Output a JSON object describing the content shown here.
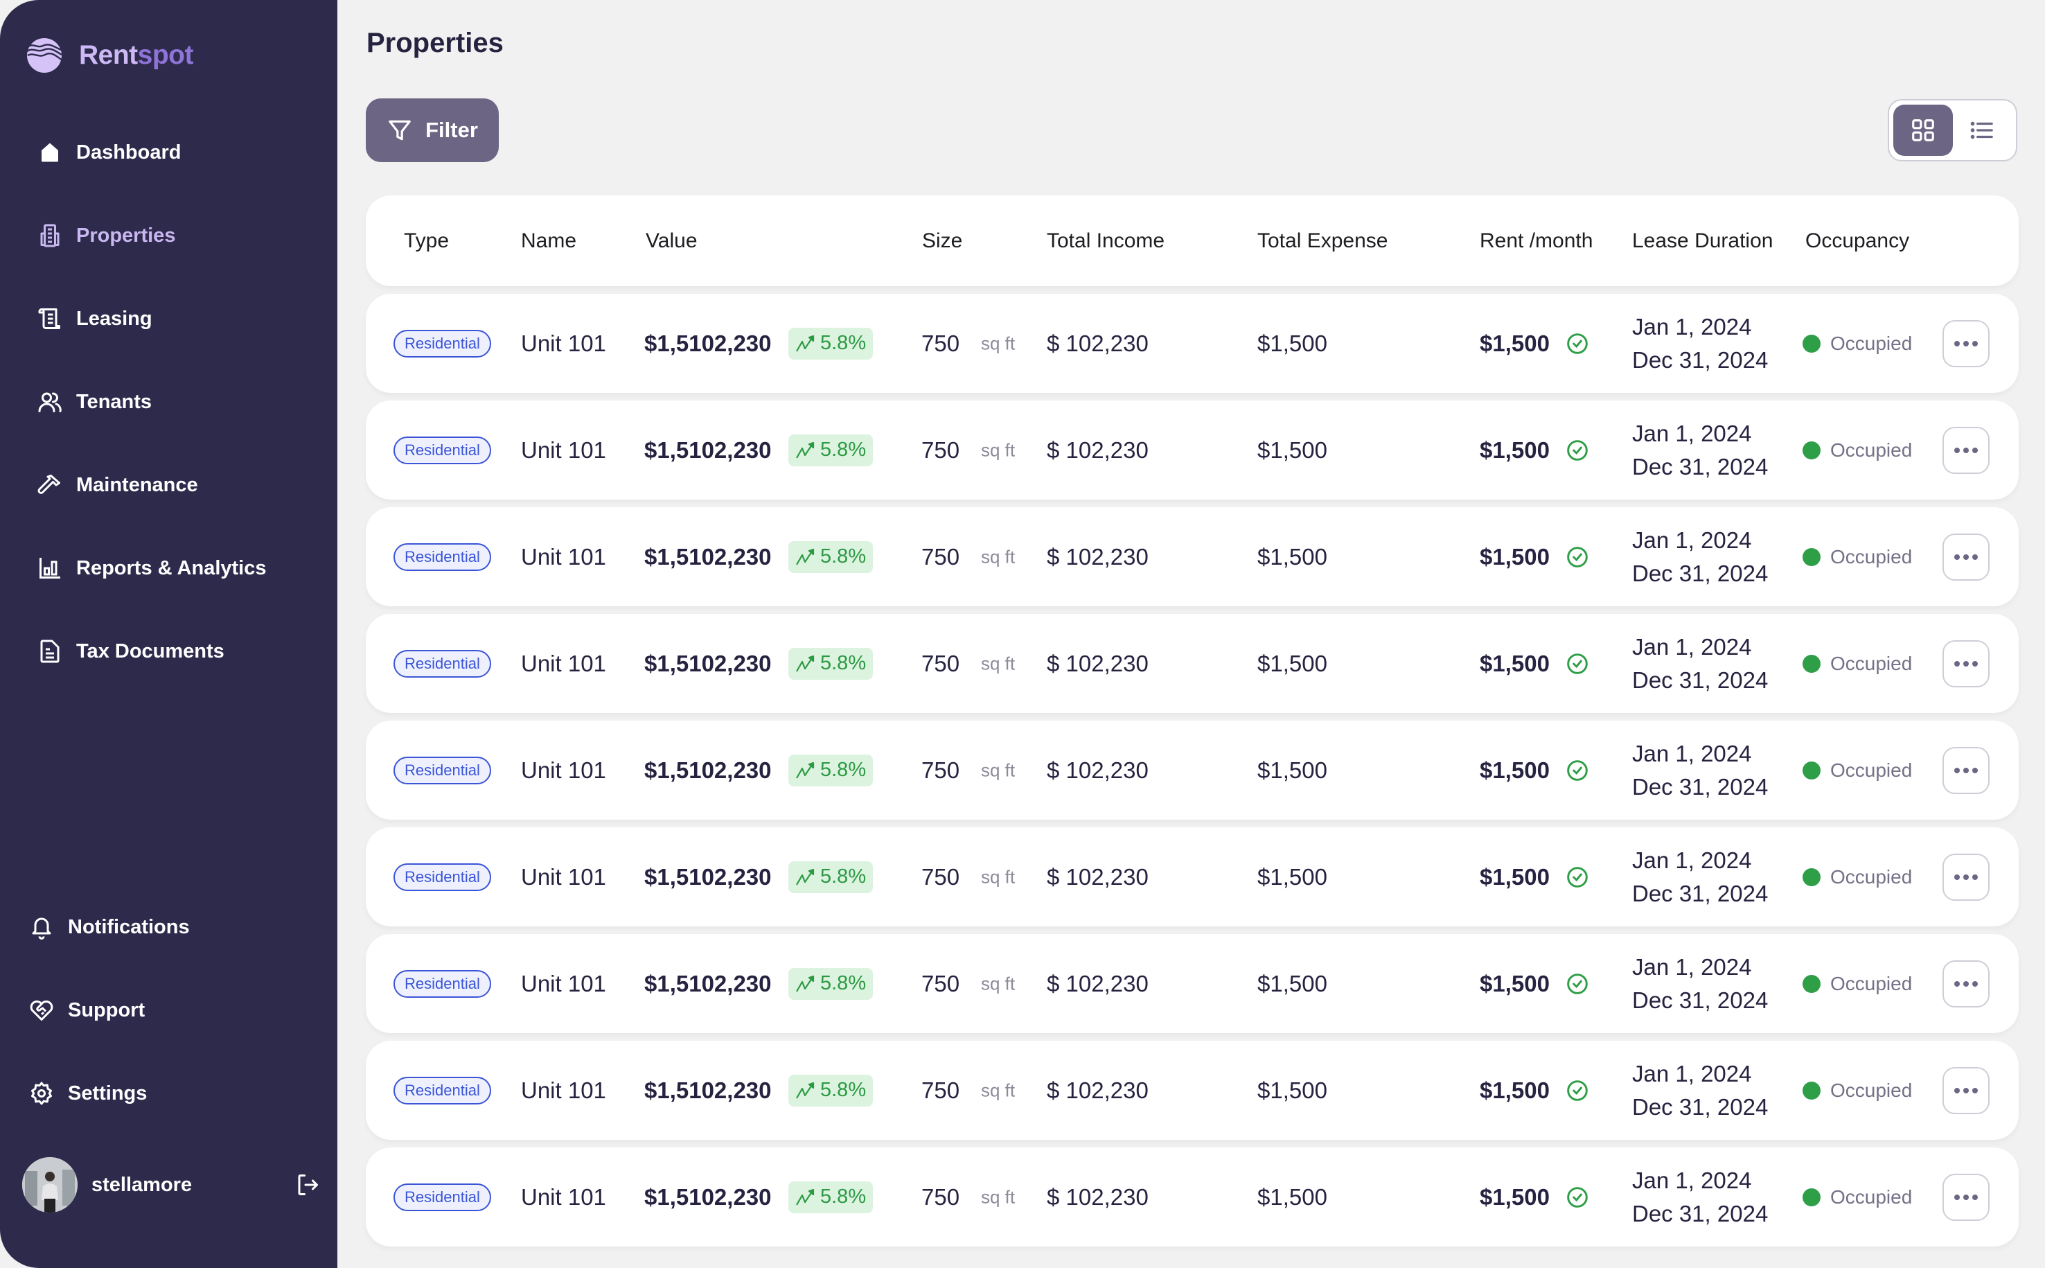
{
  "app": {
    "name_part1": "Rent",
    "name_part2": "spot",
    "logo_icon": "wave-globe-icon"
  },
  "colors": {
    "sidebar_bg": "#2e2a4c",
    "accent": "#6c6584",
    "active_nav": "#c9b8f0",
    "badge_blue": "#3b55d6",
    "success_green": "#2e9e47"
  },
  "sidebar": {
    "items": [
      {
        "label": "Dashboard",
        "icon": "home-icon",
        "active": false
      },
      {
        "label": "Properties",
        "icon": "building-icon",
        "active": true
      },
      {
        "label": "Leasing",
        "icon": "scroll-icon",
        "active": false
      },
      {
        "label": "Tenants",
        "icon": "users-icon",
        "active": false
      },
      {
        "label": "Maintenance",
        "icon": "hammer-icon",
        "active": false
      },
      {
        "label": "Reports & Analytics",
        "icon": "bar-chart-icon",
        "active": false
      },
      {
        "label": "Tax Documents",
        "icon": "document-icon",
        "active": false
      }
    ],
    "bottom_items": [
      {
        "label": "Notifications",
        "icon": "bell-icon"
      },
      {
        "label": "Support",
        "icon": "heart-handshake-icon"
      },
      {
        "label": "Settings",
        "icon": "gear-icon"
      }
    ],
    "user": {
      "username": "stellamore",
      "logout_icon": "logout-icon"
    }
  },
  "main": {
    "title": "Properties",
    "filter_label": "Filter",
    "view_toggle": {
      "options": [
        "grid",
        "list"
      ],
      "selected": "grid"
    },
    "table": {
      "columns": [
        "Type",
        "Name",
        "Value",
        "Size",
        "Total Income",
        "Total Expense",
        "Rent /month",
        "Lease Duration",
        "Occupancy"
      ],
      "rows": [
        {
          "type": "Residential",
          "name": "Unit 101",
          "value": "$1,5102,230",
          "trend": "5.8%",
          "size": "750",
          "size_unit": "sq ft",
          "total_income": "$ 102,230",
          "total_expense": "$1,500",
          "rent": "$1,500",
          "lease_start": "Jan 1, 2024",
          "lease_end": "Dec 31, 2024",
          "occupancy": "Occupied"
        },
        {
          "type": "Residential",
          "name": "Unit 101",
          "value": "$1,5102,230",
          "trend": "5.8%",
          "size": "750",
          "size_unit": "sq ft",
          "total_income": "$ 102,230",
          "total_expense": "$1,500",
          "rent": "$1,500",
          "lease_start": "Jan 1, 2024",
          "lease_end": "Dec 31, 2024",
          "occupancy": "Occupied"
        },
        {
          "type": "Residential",
          "name": "Unit 101",
          "value": "$1,5102,230",
          "trend": "5.8%",
          "size": "750",
          "size_unit": "sq ft",
          "total_income": "$ 102,230",
          "total_expense": "$1,500",
          "rent": "$1,500",
          "lease_start": "Jan 1, 2024",
          "lease_end": "Dec 31, 2024",
          "occupancy": "Occupied"
        },
        {
          "type": "Residential",
          "name": "Unit 101",
          "value": "$1,5102,230",
          "trend": "5.8%",
          "size": "750",
          "size_unit": "sq ft",
          "total_income": "$ 102,230",
          "total_expense": "$1,500",
          "rent": "$1,500",
          "lease_start": "Jan 1, 2024",
          "lease_end": "Dec 31, 2024",
          "occupancy": "Occupied"
        },
        {
          "type": "Residential",
          "name": "Unit 101",
          "value": "$1,5102,230",
          "trend": "5.8%",
          "size": "750",
          "size_unit": "sq ft",
          "total_income": "$ 102,230",
          "total_expense": "$1,500",
          "rent": "$1,500",
          "lease_start": "Jan 1, 2024",
          "lease_end": "Dec 31, 2024",
          "occupancy": "Occupied"
        },
        {
          "type": "Residential",
          "name": "Unit 101",
          "value": "$1,5102,230",
          "trend": "5.8%",
          "size": "750",
          "size_unit": "sq ft",
          "total_income": "$ 102,230",
          "total_expense": "$1,500",
          "rent": "$1,500",
          "lease_start": "Jan 1, 2024",
          "lease_end": "Dec 31, 2024",
          "occupancy": "Occupied"
        },
        {
          "type": "Residential",
          "name": "Unit 101",
          "value": "$1,5102,230",
          "trend": "5.8%",
          "size": "750",
          "size_unit": "sq ft",
          "total_income": "$ 102,230",
          "total_expense": "$1,500",
          "rent": "$1,500",
          "lease_start": "Jan 1, 2024",
          "lease_end": "Dec 31, 2024",
          "occupancy": "Occupied"
        },
        {
          "type": "Residential",
          "name": "Unit 101",
          "value": "$1,5102,230",
          "trend": "5.8%",
          "size": "750",
          "size_unit": "sq ft",
          "total_income": "$ 102,230",
          "total_expense": "$1,500",
          "rent": "$1,500",
          "lease_start": "Jan 1, 2024",
          "lease_end": "Dec 31, 2024",
          "occupancy": "Occupied"
        },
        {
          "type": "Residential",
          "name": "Unit 101",
          "value": "$1,5102,230",
          "trend": "5.8%",
          "size": "750",
          "size_unit": "sq ft",
          "total_income": "$ 102,230",
          "total_expense": "$1,500",
          "rent": "$1,500",
          "lease_start": "Jan 1, 2024",
          "lease_end": "Dec 31, 2024",
          "occupancy": "Occupied"
        }
      ]
    }
  }
}
